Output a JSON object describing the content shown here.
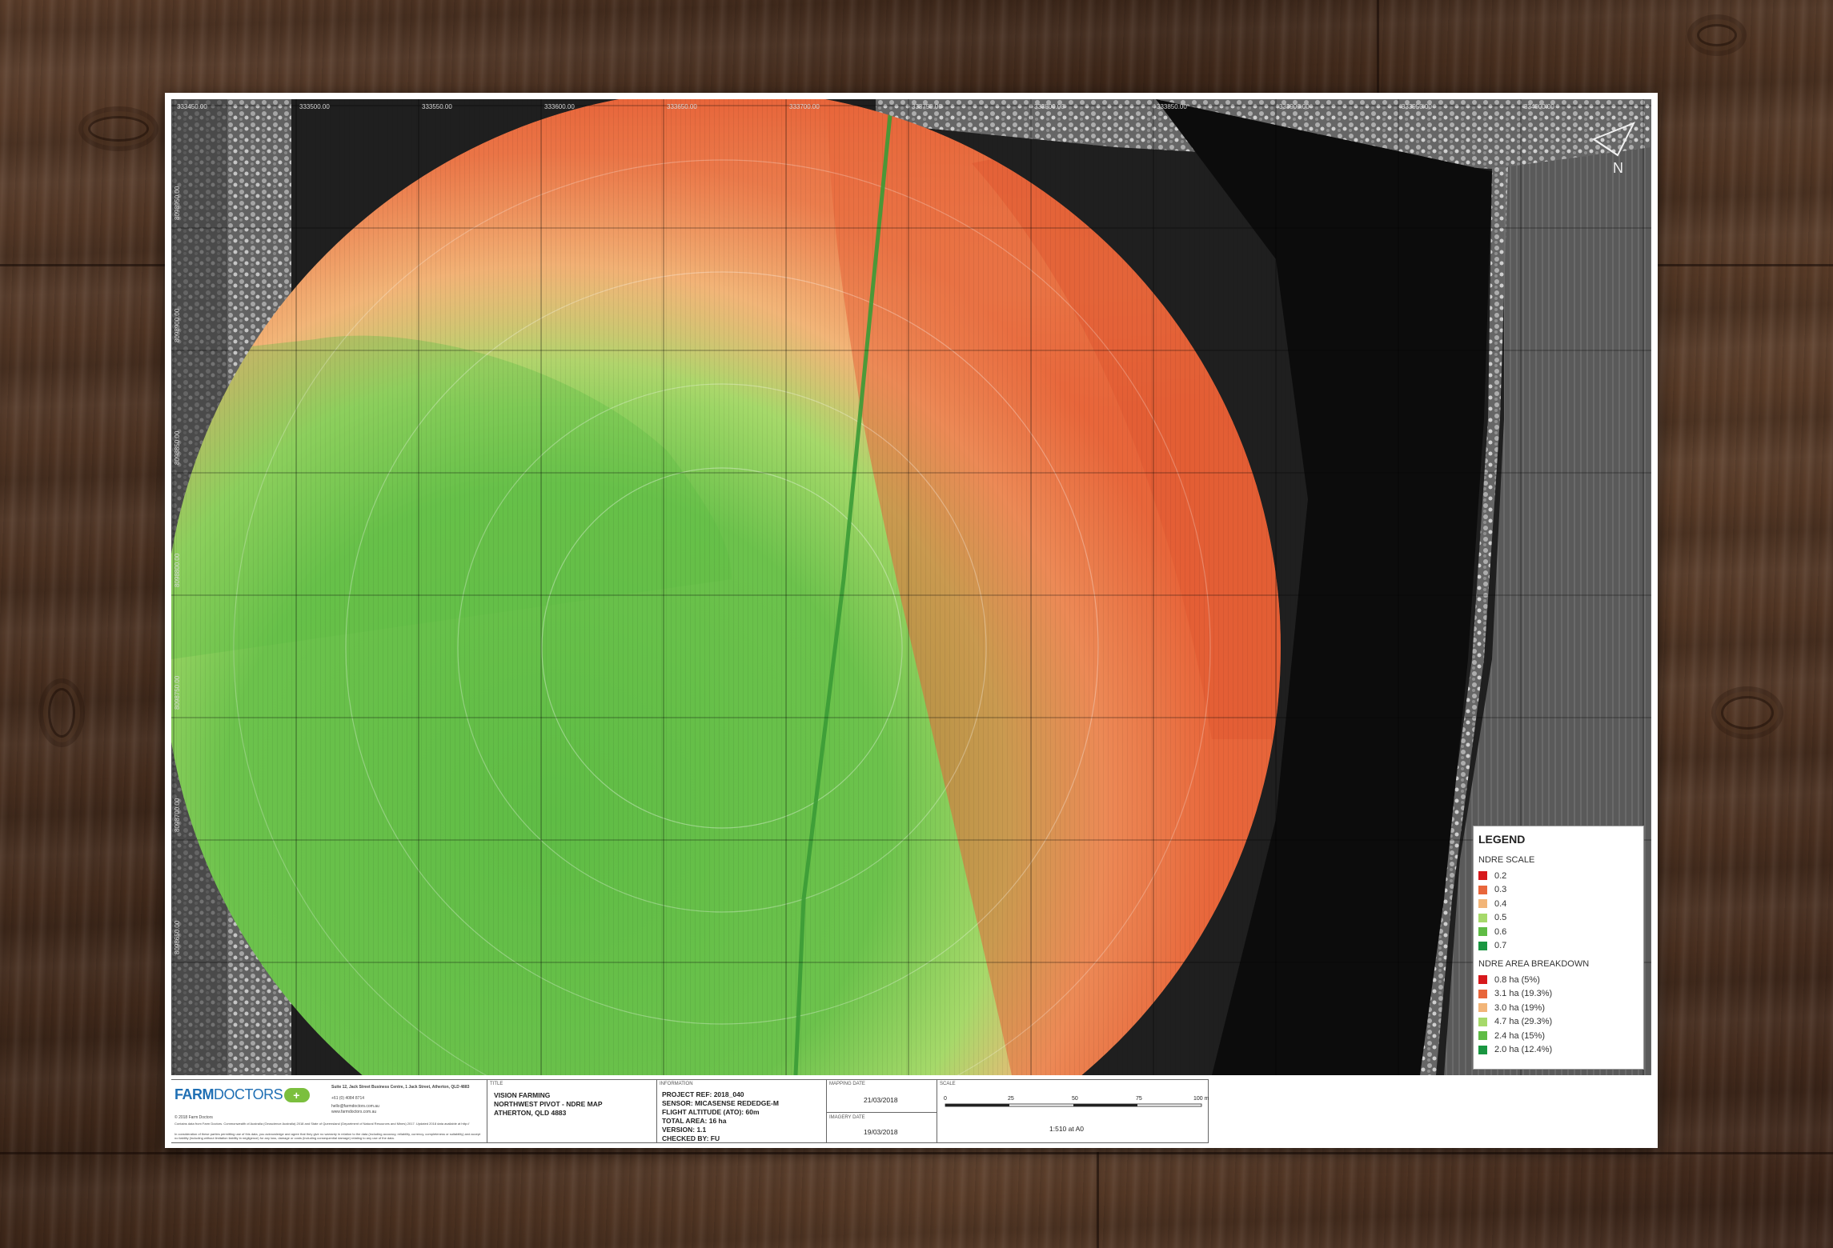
{
  "map": {
    "coords_top": [
      "333450.00",
      "333500.00",
      "333550.00",
      "333600.00",
      "333650.00",
      "333700.00",
      "333750.00",
      "333800.00",
      "333850.00",
      "333900.00",
      "333950.00",
      "334000.00"
    ],
    "coords_left": [
      "8098950.00",
      "8098900.00",
      "8098850.00",
      "8098800.00",
      "8098750.00",
      "8098700.00",
      "8098650.00"
    ],
    "north_label": "N",
    "colors": {
      "c02": "#d7191c",
      "c03": "#e8663b",
      "c04": "#f2b578",
      "c05": "#a6d96a",
      "c06": "#5fbc45",
      "c07": "#1a9641"
    }
  },
  "legend": {
    "title": "LEGEND",
    "scale_title": "NDRE SCALE",
    "scale": [
      {
        "label": "0.2",
        "color": "#d7191c"
      },
      {
        "label": "0.3",
        "color": "#e8663b"
      },
      {
        "label": "0.4",
        "color": "#f2b578"
      },
      {
        "label": "0.5",
        "color": "#a6d96a"
      },
      {
        "label": "0.6",
        "color": "#5fbc45"
      },
      {
        "label": "0.7",
        "color": "#1a9641"
      }
    ],
    "area_title": "NDRE AREA BREAKDOWN",
    "area": [
      {
        "label": "0.8 ha (5%)",
        "color": "#d7191c"
      },
      {
        "label": "3.1 ha (19.3%)",
        "color": "#e8663b"
      },
      {
        "label": "3.0 ha (19%)",
        "color": "#f2b578"
      },
      {
        "label": "4.7 ha (29.3%)",
        "color": "#a6d96a"
      },
      {
        "label": "2.4 ha (15%)",
        "color": "#5fbc45"
      },
      {
        "label": "2.0 ha (12.4%)",
        "color": "#1a9641"
      }
    ]
  },
  "titleblock": {
    "logo_farm": "FARM",
    "logo_doctors": "DOCTORS",
    "address": "Suite 12, Jack Street Business Centre, 1 Jack Street, Atherton, QLD 4883",
    "phone": "+61 (0) 4084 8714",
    "email": "hello@farmdoctors.com.au",
    "web": "www.farmdoctors.com.au",
    "copyright": "© 2018 Farm Doctors",
    "disclaimer1": "Contains data from Farm Doctors. Commonwealth of Australia (Geoscience Australia) 2018 and State of Queensland (Department of Natural Resources and Mines) 2017. Updated 2018 data available at http://",
    "disclaimer2": "In consideration of these parties permitting use of this data, you acknowledge and agree that they give no warranty in relation to the data (including accuracy, reliability, currency, completeness or suitability) and accept no liability (including without limitation liability in negligence) for any loss, damage or costs (including consequential damage) relating to any use of the data.",
    "title_head": "TITLE",
    "title_lines": [
      "VISION FARMING",
      "NORTHWEST PIVOT - NDRE MAP",
      "ATHERTON, QLD 4883"
    ],
    "info_head": "INFORMATION",
    "info_lines": [
      "PROJECT REF: 2018_040",
      "SENSOR: MICASENSE REDEDGE-M",
      "FLIGHT ALTITUDE (ATO): 60m",
      "TOTAL AREA: 16 ha",
      "VERSION: 1.1",
      "CHECKED BY: FU"
    ],
    "mapping_date_head": "MAPPING DATE",
    "mapping_date": "21/03/2018",
    "imagery_date_head": "IMAGERY DATE",
    "imagery_date": "19/03/2018",
    "scale_head": "SCALE",
    "scale_ticks": [
      "0",
      "25",
      "50",
      "75",
      "100 m"
    ],
    "scale_text": "1:510 at A0"
  }
}
